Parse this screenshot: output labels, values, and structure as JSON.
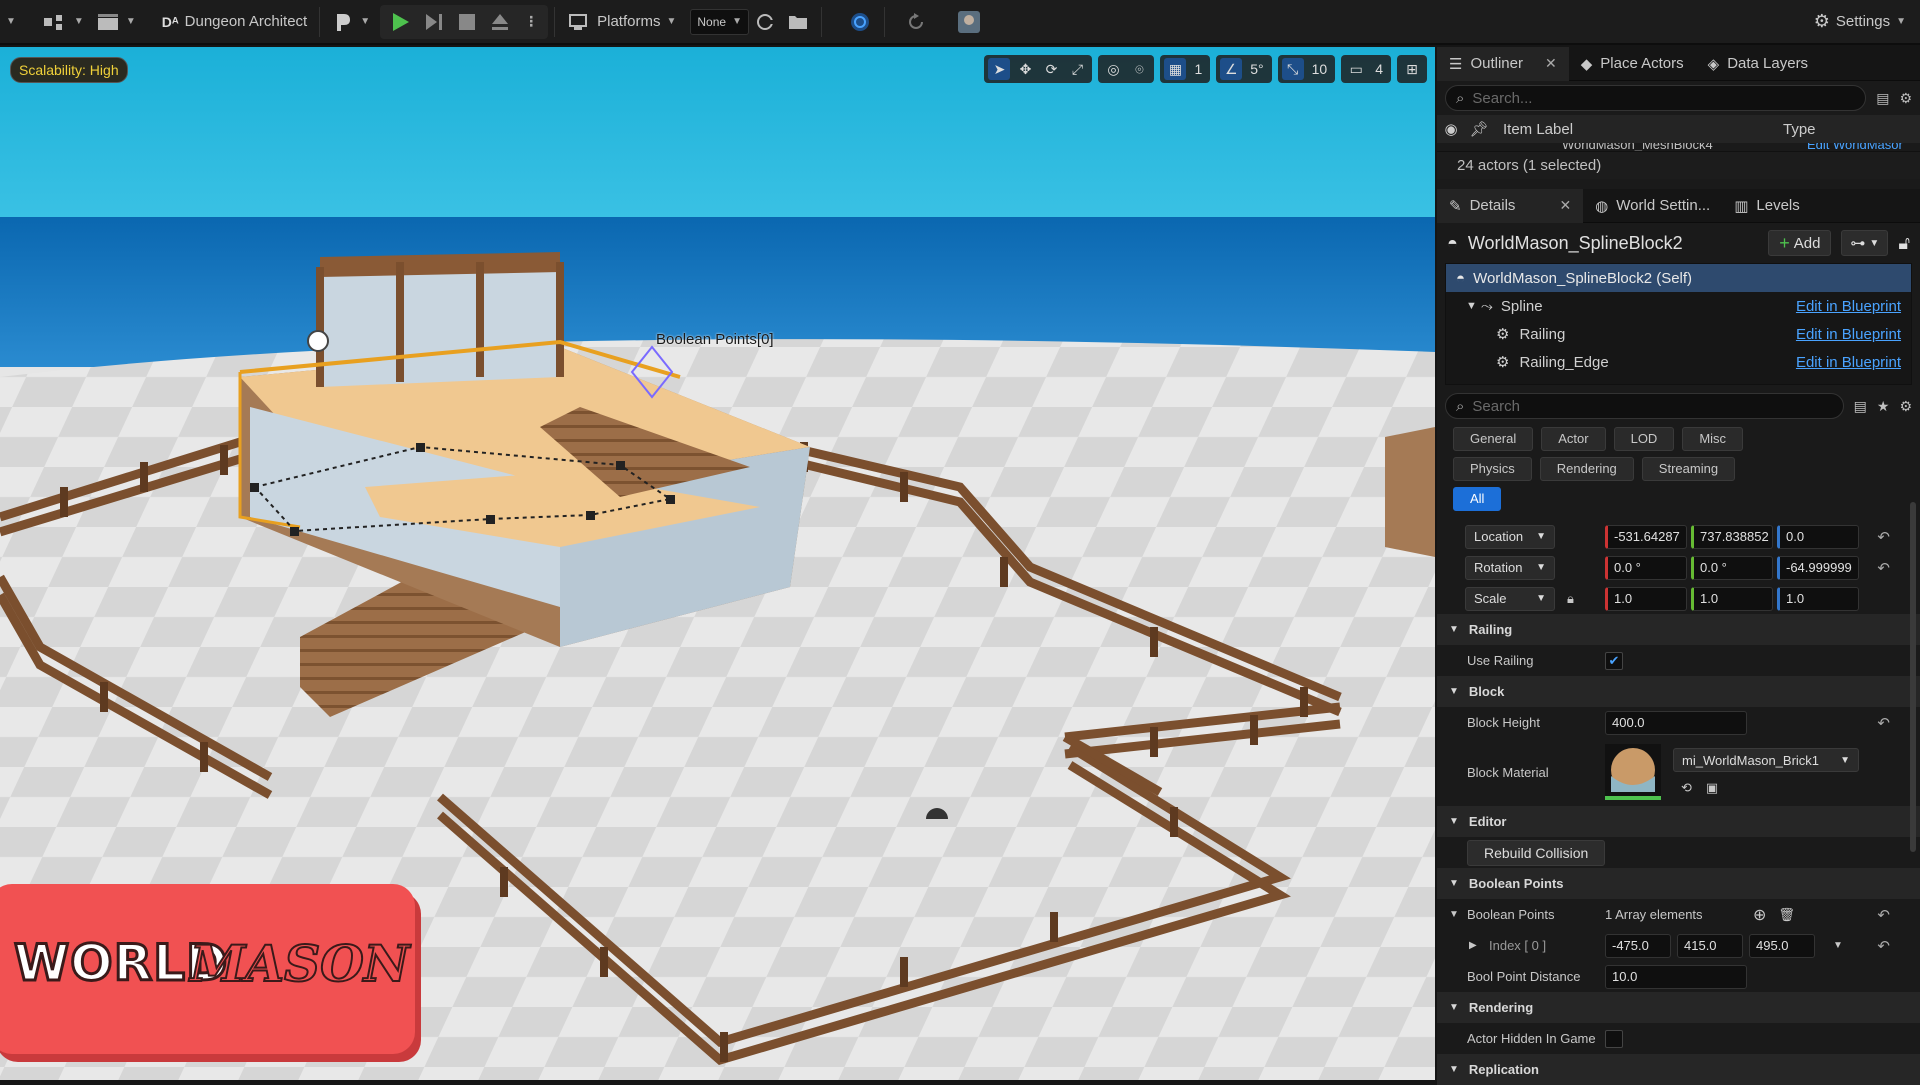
{
  "toolbar": {
    "plugin_label": "Dungeon Architect",
    "platforms_label": "Platforms",
    "none_label": "None",
    "settings_label": "Settings"
  },
  "viewport": {
    "scalability": "Scalability: High",
    "grid_snap": "1",
    "angle_snap": "5°",
    "scale_snap": "10",
    "cam_speed": "4",
    "boolean_label": "Boolean Points[0]"
  },
  "logo": {
    "word1": "WORLD",
    "word2": "MASON"
  },
  "outliner": {
    "tabs": [
      "Outliner",
      "Place Actors",
      "Data Layers"
    ],
    "search_placeholder": "Search...",
    "col_label": "Item Label",
    "col_type": "Type",
    "partial_row": "WorldMason_MeshBlock4",
    "partial_type": "Edit WorldMasor",
    "status": "24 actors (1 selected)"
  },
  "details": {
    "tabs": [
      "Details",
      "World Settin...",
      "Levels"
    ],
    "actor_name": "WorldMason_SplineBlock2",
    "add_label": "Add",
    "tree": [
      {
        "label": "WorldMason_SplineBlock2 (Self)",
        "link": ""
      },
      {
        "label": "Spline",
        "link": "Edit in Blueprint"
      },
      {
        "label": "Railing",
        "link": "Edit in Blueprint"
      },
      {
        "label": "Railing_Edge",
        "link": "Edit in Blueprint"
      }
    ],
    "search_placeholder": "Search",
    "filters": [
      "General",
      "Actor",
      "LOD",
      "Misc",
      "Physics",
      "Rendering",
      "Streaming",
      "All"
    ],
    "location": {
      "label": "Location",
      "x": "-531.64287",
      "y": "737.838852",
      "z": "0.0"
    },
    "rotation": {
      "label": "Rotation",
      "x": "0.0 °",
      "y": "0.0 °",
      "z": "-64.999999"
    },
    "scale": {
      "label": "Scale",
      "x": "1.0",
      "y": "1.0",
      "z": "1.0"
    },
    "sec_railing": "Railing",
    "use_railing": "Use Railing",
    "sec_block": "Block",
    "block_height_label": "Block Height",
    "block_height": "400.0",
    "block_material_label": "Block Material",
    "block_material": "mi_WorldMason_Brick1",
    "sec_editor": "Editor",
    "rebuild": "Rebuild Collision",
    "sec_boolean": "Boolean Points",
    "bool_points_label": "Boolean Points",
    "bool_count": "1 Array elements",
    "index_label": "Index [ 0 ]",
    "idx_x": "-475.0",
    "idx_y": "415.0",
    "idx_z": "495.0",
    "bool_dist_label": "Bool Point Distance",
    "bool_dist": "10.0",
    "sec_rendering": "Rendering",
    "hidden_label": "Actor Hidden In Game",
    "sec_replication": "Replication"
  }
}
